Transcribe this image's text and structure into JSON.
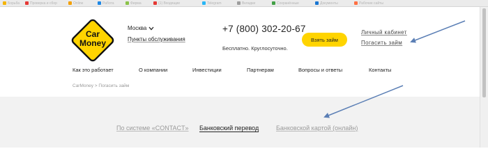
{
  "browser": {
    "bookmarks": [
      {
        "label": "Борьба",
        "color": "#f5b400"
      },
      {
        "label": "Проверка и сбор",
        "color": "#e53935"
      },
      {
        "label": "Online",
        "color": "#f4a000"
      },
      {
        "label": "Работа",
        "color": "#1e88e5"
      },
      {
        "label": "Фирма",
        "color": "#8bc34a"
      },
      {
        "label": "(1) Входящие",
        "color": "#e53935"
      },
      {
        "label": "Telegram",
        "color": "#29b6f6"
      },
      {
        "label": "Вкладки",
        "color": "#9e9e9e"
      },
      {
        "label": "Сохранённые",
        "color": "#43a047"
      },
      {
        "label": "Документы",
        "color": "#1976d2"
      },
      {
        "label": "Рабочие сайты",
        "color": "#ff7043"
      }
    ]
  },
  "header": {
    "logo": {
      "line1": "Car",
      "line2": "Money"
    },
    "city": "Москва",
    "service_points": "Пункты обслуживания",
    "phone": "+7 (800) 302-20-67",
    "phone_note": "Бесплатно. Круглосуточно.",
    "cta_label": "Взять займ",
    "cabinet_link": "Личный кабинет",
    "repay_link": "Погасить займ"
  },
  "nav": {
    "items": [
      {
        "label": "Как это работает"
      },
      {
        "label": "О компании"
      },
      {
        "label": "Инвестиции"
      },
      {
        "label": "Партнерам"
      },
      {
        "label": "Вопросы и ответы"
      },
      {
        "label": "Контакты"
      }
    ]
  },
  "breadcrumb": {
    "home": "CarMoney",
    "separator": ">",
    "current": "Погасить займ"
  },
  "payment_tabs": {
    "items": [
      {
        "label": "По системе «CONTACT»",
        "active": false
      },
      {
        "label": "Банковский перевод",
        "active": true
      },
      {
        "label": "Банковской картой (онлайн)",
        "active": false
      }
    ]
  },
  "colors": {
    "accent": "#ffd400",
    "logo_outline": "#111111",
    "annotation_arrow": "#5b7fb5",
    "band": "#f2f2f2"
  }
}
